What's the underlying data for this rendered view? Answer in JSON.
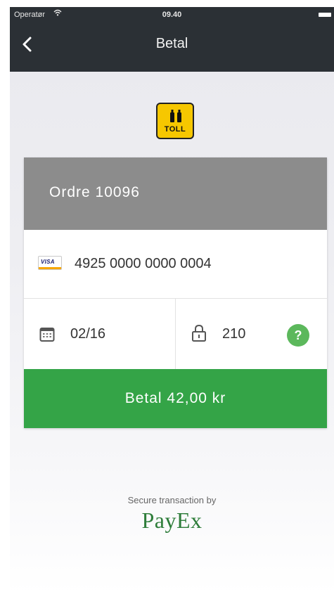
{
  "status_bar": {
    "carrier": "Operatør",
    "time": "09.40"
  },
  "nav": {
    "title": "Betal",
    "back_icon": "chevron-left-icon"
  },
  "logo": {
    "text": "TOLL",
    "color": "#f6c700"
  },
  "order": {
    "title": "Ordre 10096"
  },
  "card": {
    "brand": "VISA",
    "number": "4925 0000 0000 0004"
  },
  "expiry": {
    "value": "02/16",
    "icon": "calendar-icon"
  },
  "cvc": {
    "value": "210",
    "icon": "lock-icon",
    "help_glyph": "?"
  },
  "pay_button": {
    "label": "Betal 42,00 kr",
    "color": "#34a447"
  },
  "footer": {
    "secure_text": "Secure transaction by",
    "brand": "PayEx"
  }
}
